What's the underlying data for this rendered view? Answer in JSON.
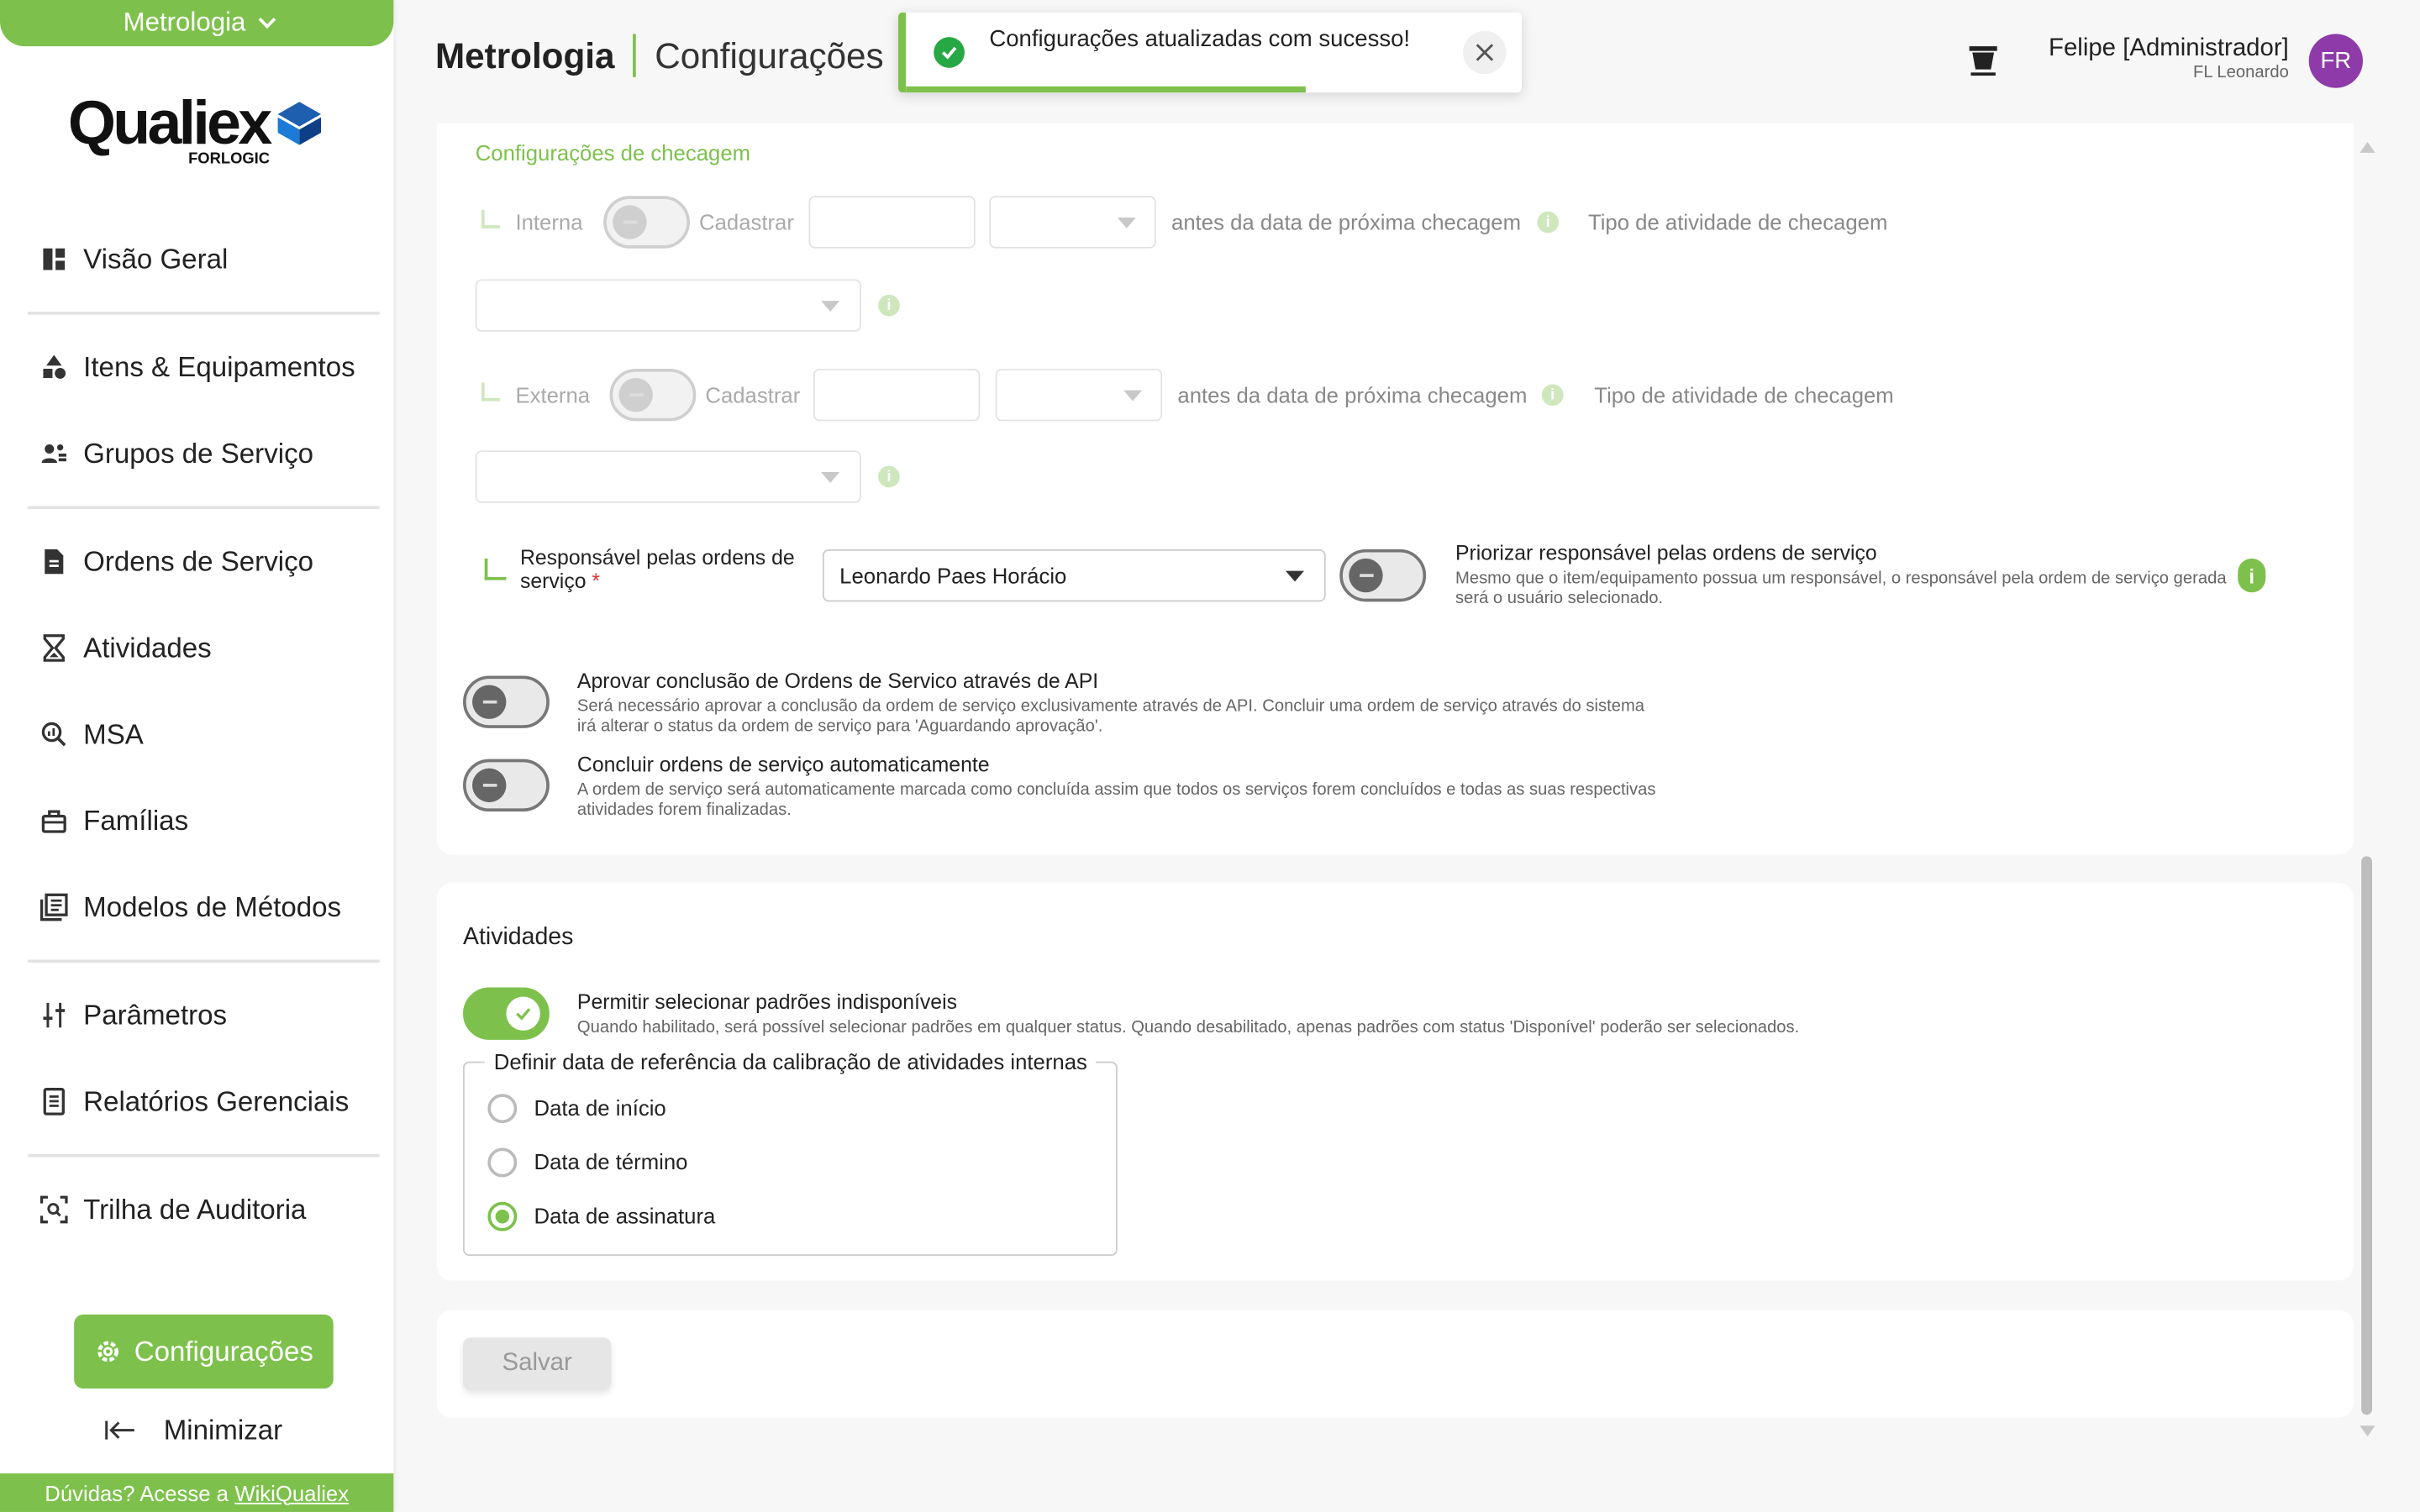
{
  "sidebar": {
    "module": "Metrologia",
    "logo": {
      "word": "Qualiex",
      "sub": "FORLOGIC"
    },
    "items": [
      {
        "label": "Visão Geral"
      },
      {
        "label": "Itens & Equipamentos"
      },
      {
        "label": "Grupos de Serviço"
      },
      {
        "label": "Ordens de Serviço"
      },
      {
        "label": "Atividades"
      },
      {
        "label": "MSA"
      },
      {
        "label": "Famílias"
      },
      {
        "label": "Modelos de Métodos"
      },
      {
        "label": "Parâmetros"
      },
      {
        "label": "Relatórios Gerenciais"
      },
      {
        "label": "Trilha de Auditoria"
      }
    ],
    "config_button": "Configurações",
    "minimize": "Minimizar",
    "help_text": "Dúvidas? Acesse a",
    "help_link": "WikiQualiex"
  },
  "header": {
    "module": "Metrologia",
    "page": "Configurações",
    "toast": {
      "message": "Configurações atualizadas com sucesso!",
      "progress": 0.65
    },
    "user_name": "Felipe [Administrador]",
    "company": "FL Leonardo",
    "avatar": "FR"
  },
  "checks": {
    "section_title": "Configurações de checagem",
    "internal": {
      "label": "Interna",
      "register": "Cadastrar",
      "before": "antes da data de próxima checagem",
      "activity_type": "Tipo de atividade de checagem"
    },
    "external": {
      "label": "Externa",
      "register": "Cadastrar",
      "before": "antes da data de próxima checagem",
      "activity_type": "Tipo de atividade de checagem"
    },
    "responsible": {
      "label": "Responsável pelas ordens de serviço",
      "required": "*",
      "value": "Leonardo Paes Horácio"
    },
    "prioritize": {
      "title": "Priorizar responsável pelas ordens de serviço",
      "desc": "Mesmo que o item/equipamento possua um responsável, o responsável pela ordem de serviço gerada será o usuário selecionado."
    },
    "approve_api": {
      "title": "Aprovar conclusão de Ordens de Servico através de API",
      "desc": "Será necessário aprovar a conclusão da ordem de serviço exclusivamente através de API. Concluir uma ordem de serviço através do sistema irá alterar o status da ordem de serviço para 'Aguardando aprovação'."
    },
    "auto_close": {
      "title": "Concluir ordens de serviço automaticamente",
      "desc": "A ordem de serviço será automaticamente marcada como concluída assim que todos os serviços forem concluídos e todas as suas respectivas atividades forem finalizadas."
    }
  },
  "activities": {
    "title": "Atividades",
    "allow_unavailable": {
      "title": "Permitir selecionar padrões indisponíveis",
      "desc": "Quando habilitado, será possível selecionar padrões em qualquer status. Quando desabilitado, apenas padrões com status 'Disponível' poderão ser selecionados."
    },
    "reference_legend": "Definir data de referência da calibração de atividades internas",
    "options": [
      "Data de início",
      "Data de término",
      "Data de assinatura"
    ],
    "selected": "Data de assinatura"
  },
  "actions": {
    "save": "Salvar"
  },
  "colors": {
    "brand": "#7dc14c",
    "avatar": "#8e3aa8",
    "success": "#27a844"
  }
}
